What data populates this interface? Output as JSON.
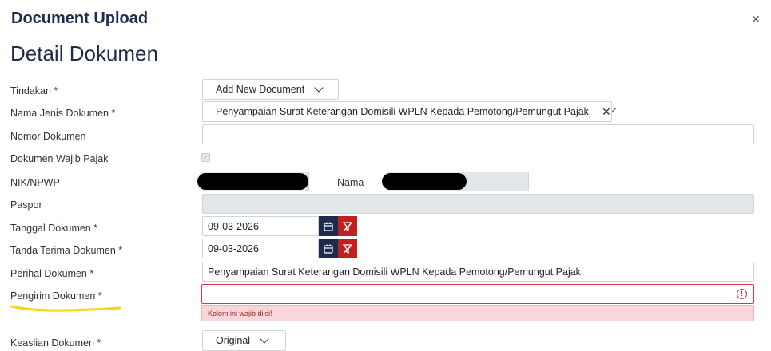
{
  "dialog": {
    "title": "Document Upload",
    "close_symbol": "×"
  },
  "section": {
    "title": "Detail Dokumen"
  },
  "labels": {
    "tindakan": "Tindakan *",
    "nama_jenis": "Nama Jenis Dokumen *",
    "nomor": "Nomor Dokumen",
    "wajib_pajak": "Dokumen Wajib Pajak",
    "nik_npwp": "NIK/NPWP",
    "nama": "Nama",
    "paspor": "Paspor",
    "tanggal": "Tanggal Dokumen *",
    "tanda_terima": "Tanda Terima Dokumen *",
    "perihal": "Perihal Dokumen *",
    "pengirim": "Pengirim Dokumen *",
    "keaslian": "Keaslian Dokumen *"
  },
  "fields": {
    "tindakan_value": "Add New Document",
    "nama_jenis_value": "Penyampaian Surat Keterangan Domisili WPLN Kepada Pemotong/Pemungut Pajak",
    "nomor_value": "",
    "tanggal_value": "09-03-2026",
    "tanda_terima_value": "09-03-2026",
    "perihal_value": "Penyampaian Surat Keterangan Domisili WPLN Kepada Pemotong/Pemungut Pajak",
    "pengirim_value": "",
    "keaslian_value": "Original",
    "wajib_pajak_checked": true
  },
  "validation": {
    "pengirim_error": "Kolom ini wajib diisi!"
  },
  "colors": {
    "primary": "#1f2a4d",
    "danger": "#c0201f",
    "highlight": "#f5d90a"
  }
}
